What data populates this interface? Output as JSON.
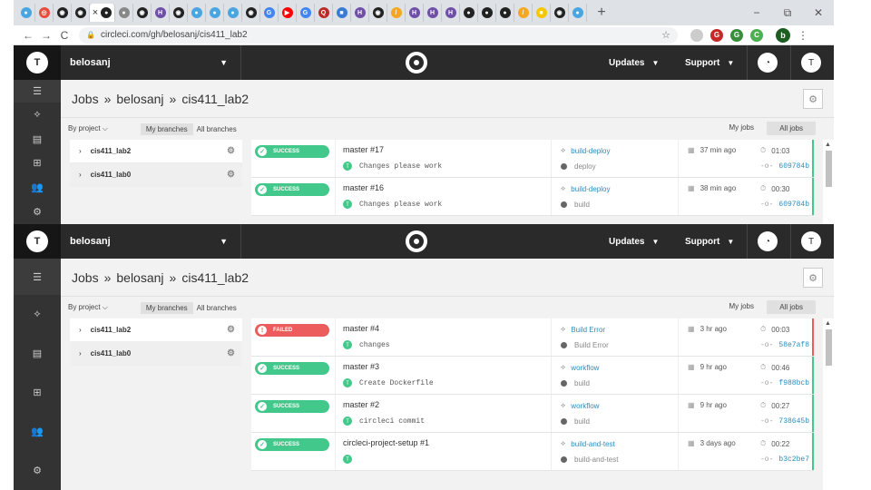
{
  "browser": {
    "tab_favicons": [
      {
        "name": "circleci-tab",
        "color": "#4aa6e0",
        "glyph": "●"
      },
      {
        "name": "lifebuoy-tab",
        "color": "#e74c3c",
        "glyph": "◎"
      },
      {
        "name": "github-tab",
        "color": "#222222",
        "glyph": "◉"
      },
      {
        "name": "github-tab",
        "color": "#222222",
        "glyph": "◉"
      },
      {
        "name": "active-tab",
        "color": "#222222",
        "glyph": "●"
      },
      {
        "name": "circleci-tab",
        "color": "#888888",
        "glyph": "●"
      },
      {
        "name": "github-tab",
        "color": "#222222",
        "glyph": "◉"
      },
      {
        "name": "heroku-tab",
        "color": "#6f4fa8",
        "glyph": "H"
      },
      {
        "name": "github-tab",
        "color": "#222222",
        "glyph": "◉"
      },
      {
        "name": "circleci-tab",
        "color": "#4aa6e0",
        "glyph": "●"
      },
      {
        "name": "circleci-tab",
        "color": "#4aa6e0",
        "glyph": "●"
      },
      {
        "name": "circleci-tab",
        "color": "#4aa6e0",
        "glyph": "●"
      },
      {
        "name": "github-tab",
        "color": "#222222",
        "glyph": "◉"
      },
      {
        "name": "google-tab",
        "color": "#4285f4",
        "glyph": "G"
      },
      {
        "name": "youtube-tab",
        "color": "#ff0000",
        "glyph": "▶"
      },
      {
        "name": "google-tab",
        "color": "#4285f4",
        "glyph": "G"
      },
      {
        "name": "quora-tab",
        "color": "#b92b27",
        "glyph": "Q"
      },
      {
        "name": "bookmark-tab",
        "color": "#3a7bd5",
        "glyph": "■"
      },
      {
        "name": "heroku-tab",
        "color": "#6f4fa8",
        "glyph": "H"
      },
      {
        "name": "github-tab",
        "color": "#222222",
        "glyph": "◉"
      },
      {
        "name": "orange-tab",
        "color": "#f5a623",
        "glyph": "/"
      },
      {
        "name": "heroku-tab",
        "color": "#6f4fa8",
        "glyph": "H"
      },
      {
        "name": "heroku-tab",
        "color": "#6f4fa8",
        "glyph": "H"
      },
      {
        "name": "heroku-tab",
        "color": "#6f4fa8",
        "glyph": "H"
      },
      {
        "name": "circleci-tab",
        "color": "#222222",
        "glyph": "●"
      },
      {
        "name": "circleci-tab",
        "color": "#222222",
        "glyph": "●"
      },
      {
        "name": "circleci-tab",
        "color": "#222222",
        "glyph": "●"
      },
      {
        "name": "orange-tab",
        "color": "#f5a623",
        "glyph": "/"
      },
      {
        "name": "yellow-tab",
        "color": "#f6c600",
        "glyph": "■"
      },
      {
        "name": "github-tab",
        "color": "#222222",
        "glyph": "◉"
      },
      {
        "name": "circleci-tab",
        "color": "#4aa6e0",
        "glyph": "●"
      }
    ],
    "active_tab_close": "×",
    "new_tab": "+",
    "win_min": "−",
    "win_restore": "⧉",
    "win_close": "✕",
    "back": "←",
    "forward": "→",
    "reload": "C",
    "url": "circleci.com/gh/belosanj/cis411_lab2",
    "profile_initial": "b",
    "kebab": "⋮"
  },
  "upper": {
    "account": "belosanj",
    "updates": "Updates",
    "support": "Support",
    "breadcrumb": {
      "root": "Jobs",
      "sep1": "»",
      "org": "belosanj",
      "sep2": "»",
      "repo": "cis411_lab2"
    },
    "filter": {
      "by_project": "By project",
      "my_branches": "My branches",
      "all_branches": "All branches",
      "my_jobs": "My jobs",
      "all_jobs": "All jobs"
    },
    "projects": [
      {
        "name": "cis411_lab2"
      },
      {
        "name": "cis411_lab0"
      }
    ],
    "jobs": [
      {
        "status": "SUCCESS",
        "title": "master #17",
        "commit": "Changes please work",
        "workflow": "build-deploy",
        "job": "deploy",
        "date": "37 min ago",
        "duration": "01:03",
        "sha": "609784b"
      },
      {
        "status": "SUCCESS",
        "title": "master #16",
        "commit": "Changes please work",
        "workflow": "build-deploy",
        "job": "build",
        "date": "38 min ago",
        "duration": "00:30",
        "sha": "609784b"
      }
    ]
  },
  "lower": {
    "account": "belosanj",
    "updates": "Updates",
    "support": "Support",
    "breadcrumb": {
      "root": "Jobs",
      "sep1": "»",
      "org": "belosanj",
      "sep2": "»",
      "repo": "cis411_lab2"
    },
    "filter": {
      "by_project": "By project",
      "my_branches": "My branches",
      "all_branches": "All branches",
      "my_jobs": "My jobs",
      "all_jobs": "All jobs"
    },
    "projects": [
      {
        "name": "cis411_lab2"
      },
      {
        "name": "cis411_lab0"
      }
    ],
    "jobs": [
      {
        "status": "FAILED",
        "title": "master #4",
        "commit": "changes",
        "workflow": "Build Error",
        "job": "Build Error",
        "date": "3 hr ago",
        "duration": "00:03",
        "sha": "58e7af8"
      },
      {
        "status": "SUCCESS",
        "title": "master #3",
        "commit": "Create Dockerfile",
        "workflow": "workflow",
        "job": "build",
        "date": "9 hr ago",
        "duration": "00:46",
        "sha": "f988bcb"
      },
      {
        "status": "SUCCESS",
        "title": "master #2",
        "commit": "circleci commit",
        "workflow": "workflow",
        "job": "build",
        "date": "9 hr ago",
        "duration": "00:27",
        "sha": "738645b"
      },
      {
        "status": "SUCCESS",
        "title": "circleci-project-setup #1",
        "commit": "",
        "workflow": "build-and-test",
        "job": "build-and-test",
        "date": "3 days ago",
        "duration": "00:22",
        "sha": "b3c2be7"
      }
    ]
  },
  "colors": {
    "success": "#42c88a",
    "failed": "#ed5c5c",
    "topbar": "#2a2a2a",
    "link": "#2a8bbf"
  }
}
